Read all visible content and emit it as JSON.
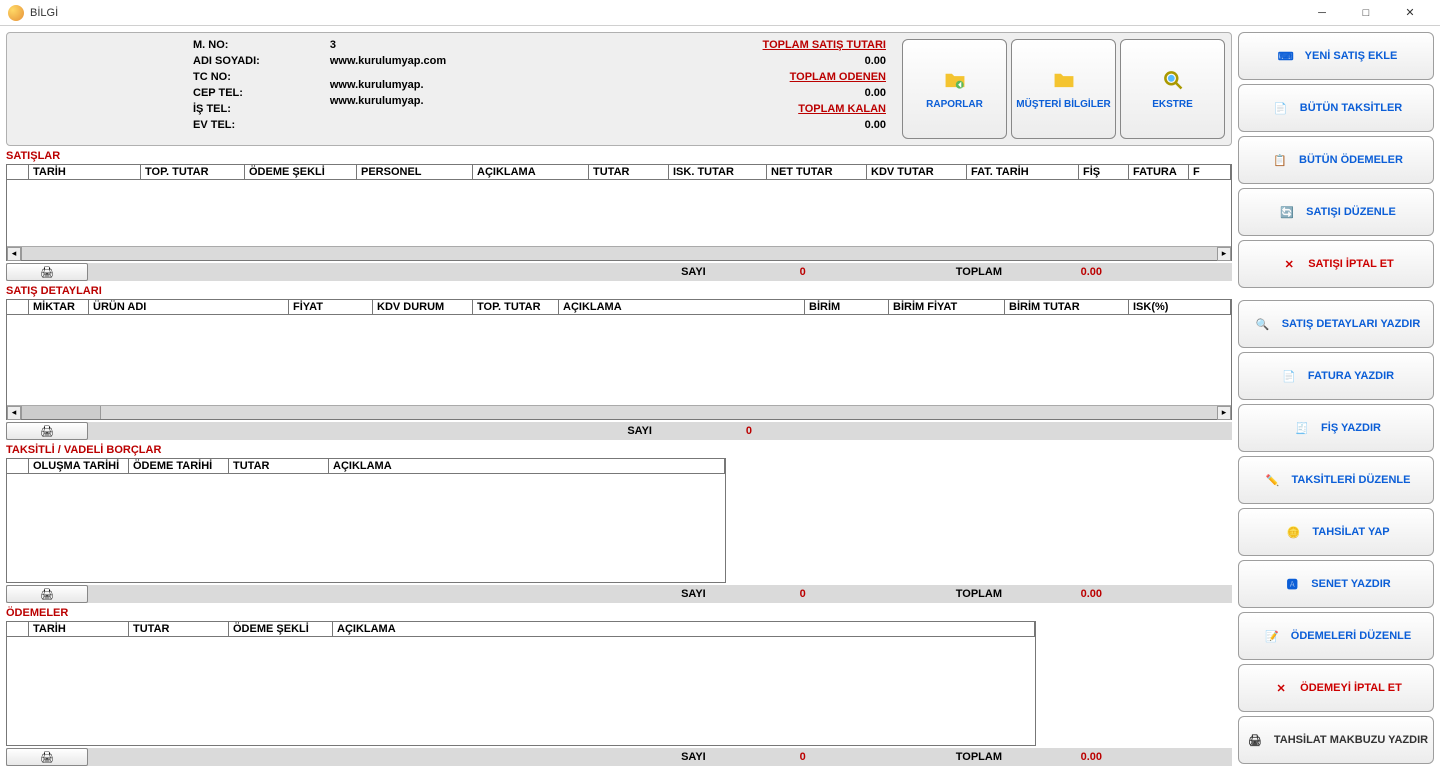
{
  "window": {
    "title": "BİLGİ"
  },
  "customer": {
    "fields": {
      "mno": "M. NO:",
      "adsoy": "ADI SOYADI:",
      "tcno": "TC NO:",
      "cep": "CEP TEL:",
      "is": "İŞ TEL:",
      "ev": "EV TEL:"
    },
    "values": {
      "mno": "3",
      "adsoy": "www.kurulumyap.com",
      "tcno": "",
      "cep": "",
      "is": "www.kurulumyap.",
      "ev": "www.kurulumyap."
    }
  },
  "totals": {
    "labels": {
      "satis": "TOPLAM SATIŞ TUTARI",
      "odenen": "TOPLAM ODENEN",
      "kalan": "TOPLAM KALAN"
    },
    "values": {
      "satis": "0.00",
      "odenen": "0.00",
      "kalan": "0.00"
    }
  },
  "cards": {
    "raporlar": "RAPORLAR",
    "musteri": "MÜŞTERİ BİLGİLER",
    "ekstre": "EKSTRE"
  },
  "sections": {
    "satislar": {
      "title": "SATIŞLAR",
      "headers": [
        "TARİH",
        "TOP. TUTAR",
        "ÖDEME ŞEKLİ",
        "PERSONEL",
        "AÇIKLAMA",
        "TUTAR",
        "ISK. TUTAR",
        "NET TUTAR",
        "KDV TUTAR",
        "FAT. TARİH",
        "FİŞ",
        "FATURA",
        "F"
      ],
      "footer": {
        "sayi_lbl": "SAYI",
        "sayi": "0",
        "toplam_lbl": "TOPLAM",
        "toplam": "0.00"
      }
    },
    "detaylar": {
      "title": "SATIŞ DETAYLARI",
      "headers": [
        "MİKTAR",
        "ÜRÜN ADI",
        "FİYAT",
        "KDV DURUM",
        "TOP. TUTAR",
        "AÇIKLAMA",
        "BİRİM",
        "BİRİM FİYAT",
        "BİRİM TUTAR",
        "ISK(%)"
      ],
      "footer": {
        "sayi_lbl": "SAYI",
        "sayi": "0"
      }
    },
    "taksit": {
      "title": "TAKSİTLİ / VADELİ BORÇLAR",
      "headers": [
        "OLUŞMA TARİHİ",
        "ÖDEME TARİHİ",
        "TUTAR",
        "AÇIKLAMA"
      ],
      "footer": {
        "sayi_lbl": "SAYI",
        "sayi": "0",
        "toplam_lbl": "TOPLAM",
        "toplam": "0.00"
      }
    },
    "odemeler": {
      "title": "ÖDEMELER",
      "headers": [
        "TARİH",
        "TUTAR",
        "ÖDEME ŞEKLİ",
        "AÇIKLAMA"
      ],
      "footer": {
        "sayi_lbl": "SAYI",
        "sayi": "0",
        "toplam_lbl": "TOPLAM",
        "toplam": "0.00"
      }
    }
  },
  "sidebar": {
    "items": [
      {
        "label": "YENİ SATIŞ EKLE"
      },
      {
        "label": "BÜTÜN TAKSİTLER"
      },
      {
        "label": "BÜTÜN ÖDEMELER"
      },
      {
        "label": "SATIŞI DÜZENLE"
      },
      {
        "label": "SATIŞI İPTAL ET"
      },
      {
        "label": "SATIŞ DETAYLARI YAZDIR"
      },
      {
        "label": "FATURA YAZDIR"
      },
      {
        "label": "FİŞ YAZDIR"
      },
      {
        "label": "TAKSİTLERİ DÜZENLE"
      },
      {
        "label": "TAHSİLAT YAP"
      },
      {
        "label": "SENET YAZDIR"
      },
      {
        "label": "ÖDEMELERİ DÜZENLE"
      },
      {
        "label": "ÖDEMEYİ İPTAL ET"
      },
      {
        "label": "TAHSİLAT MAKBUZU YAZDIR"
      }
    ]
  }
}
